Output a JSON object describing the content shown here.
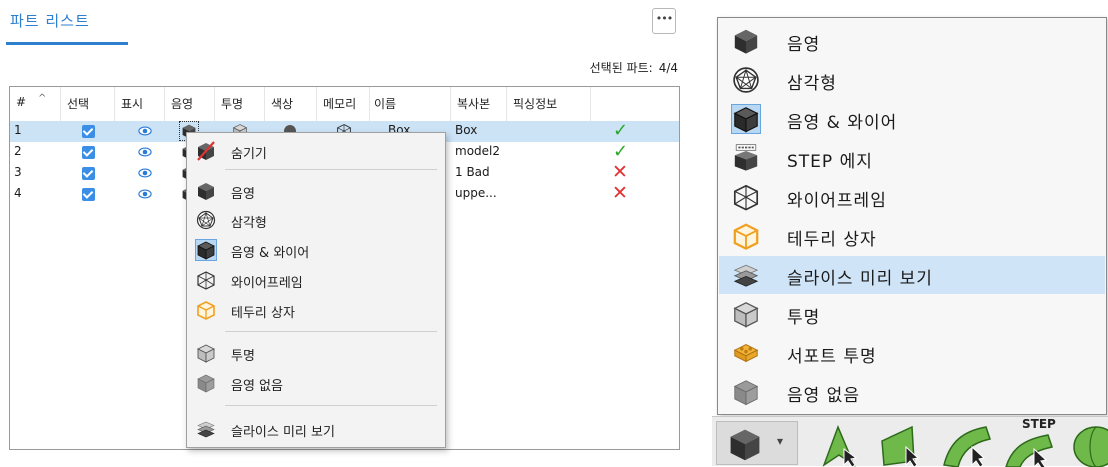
{
  "left": {
    "tab_label": "파트 리스트",
    "more_label": "•••",
    "selected_label": "선택된 파트:",
    "selected_value": "4/4",
    "headers": [
      "#",
      "^",
      "선택",
      "표시",
      "음영",
      "투명",
      "색상",
      "메모리",
      "이름",
      "복사본",
      "픽싱정보"
    ],
    "rows": [
      {
        "num": "1",
        "name": "Box",
        "copy": "Box",
        "status": "ok"
      },
      {
        "num": "2",
        "name": "",
        "copy": "model2",
        "status": "ok"
      },
      {
        "num": "3",
        "name": "",
        "copy": "1 Bad",
        "status": "bad"
      },
      {
        "num": "4",
        "name": "",
        "copy": "uppe...",
        "status": "bad"
      }
    ],
    "context_menu": [
      {
        "label": "숨기기",
        "icon": "hide-icon"
      },
      {
        "label": "음영",
        "icon": "shaded-cube-icon"
      },
      {
        "label": "삼각형",
        "icon": "triangle-mesh-icon"
      },
      {
        "label": "음영 & 와이어",
        "icon": "shaded-wire-cube-icon"
      },
      {
        "label": "와이어프레임",
        "icon": "wireframe-cube-icon"
      },
      {
        "label": "테두리 상자",
        "icon": "bounding-box-icon"
      },
      {
        "label": "투명",
        "icon": "transparent-cube-icon"
      },
      {
        "label": "음영 없음",
        "icon": "no-shade-cube-icon"
      },
      {
        "label": "슬라이스 미리 보기",
        "icon": "slice-preview-icon"
      }
    ]
  },
  "right": {
    "menu": [
      {
        "label": "음영",
        "icon": "shaded-cube-icon"
      },
      {
        "label": "삼각형",
        "icon": "triangle-mesh-icon"
      },
      {
        "label": "음영 & 와이어",
        "icon": "shaded-wire-cube-icon"
      },
      {
        "label": "STEP 에지",
        "icon": "step-edge-icon"
      },
      {
        "label": "와이어프레임",
        "icon": "wireframe-cube-icon"
      },
      {
        "label": "테두리 상자",
        "icon": "bounding-box-icon"
      },
      {
        "label": "슬라이스 미리 보기",
        "icon": "slice-preview-icon"
      },
      {
        "label": "투명",
        "icon": "transparent-cube-icon"
      },
      {
        "label": "서포트 투명",
        "icon": "support-transparent-icon"
      },
      {
        "label": "음영 없음",
        "icon": "no-shade-cube-icon"
      }
    ],
    "highlighted_item": "슬라이스 미리 보기",
    "toolbar_step_label": "STEP"
  },
  "colors": {
    "accent": "#2f7fcf",
    "selection": "#cce3f6",
    "ok": "#2aa82a",
    "bad": "#e03333",
    "cube": "#333333",
    "orange": "#f0a020",
    "green_tool": "#6fb84a"
  }
}
